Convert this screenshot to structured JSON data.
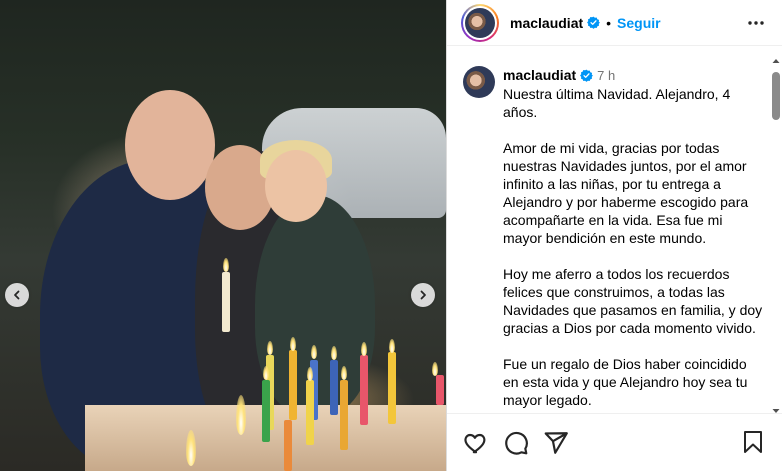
{
  "post": {
    "photo_alt": "",
    "carousel": {
      "prev_icon": "chevron-left-icon",
      "next_icon": "chevron-right-icon"
    }
  },
  "header": {
    "username": "maclaudiat",
    "separator": "•",
    "follow_label": "Seguir",
    "more_icon": "more-horizontal-icon"
  },
  "caption": {
    "username": "maclaudiat",
    "time": "7 h",
    "text": "Nuestra última Navidad. Alejandro, 4 años.\n\nAmor de mi vida, gracias por todas nuestras Navidades juntos, por el amor infinito a las niñas, por tu entrega a Alejandro y por haberme escogido para acompañarte en la vida. Esa fue mi mayor bendición en este mundo.\n\nHoy me aferro a todos los recuerdos felices que construimos, a todas las Navidades que pasamos en familia, y doy gracias a Dios por cada momento vivido.\n\nFue un regalo de Dios haber coincidido en esta vida y que Alejandro hoy sea tu mayor legado."
  },
  "actions": {
    "like_icon": "heart-icon",
    "comment_icon": "comment-icon",
    "share_icon": "share-icon",
    "save_icon": "bookmark-icon"
  },
  "colors": {
    "accent": "#0095f6",
    "verified": "#0095f6",
    "border": "#dbdbdb"
  }
}
